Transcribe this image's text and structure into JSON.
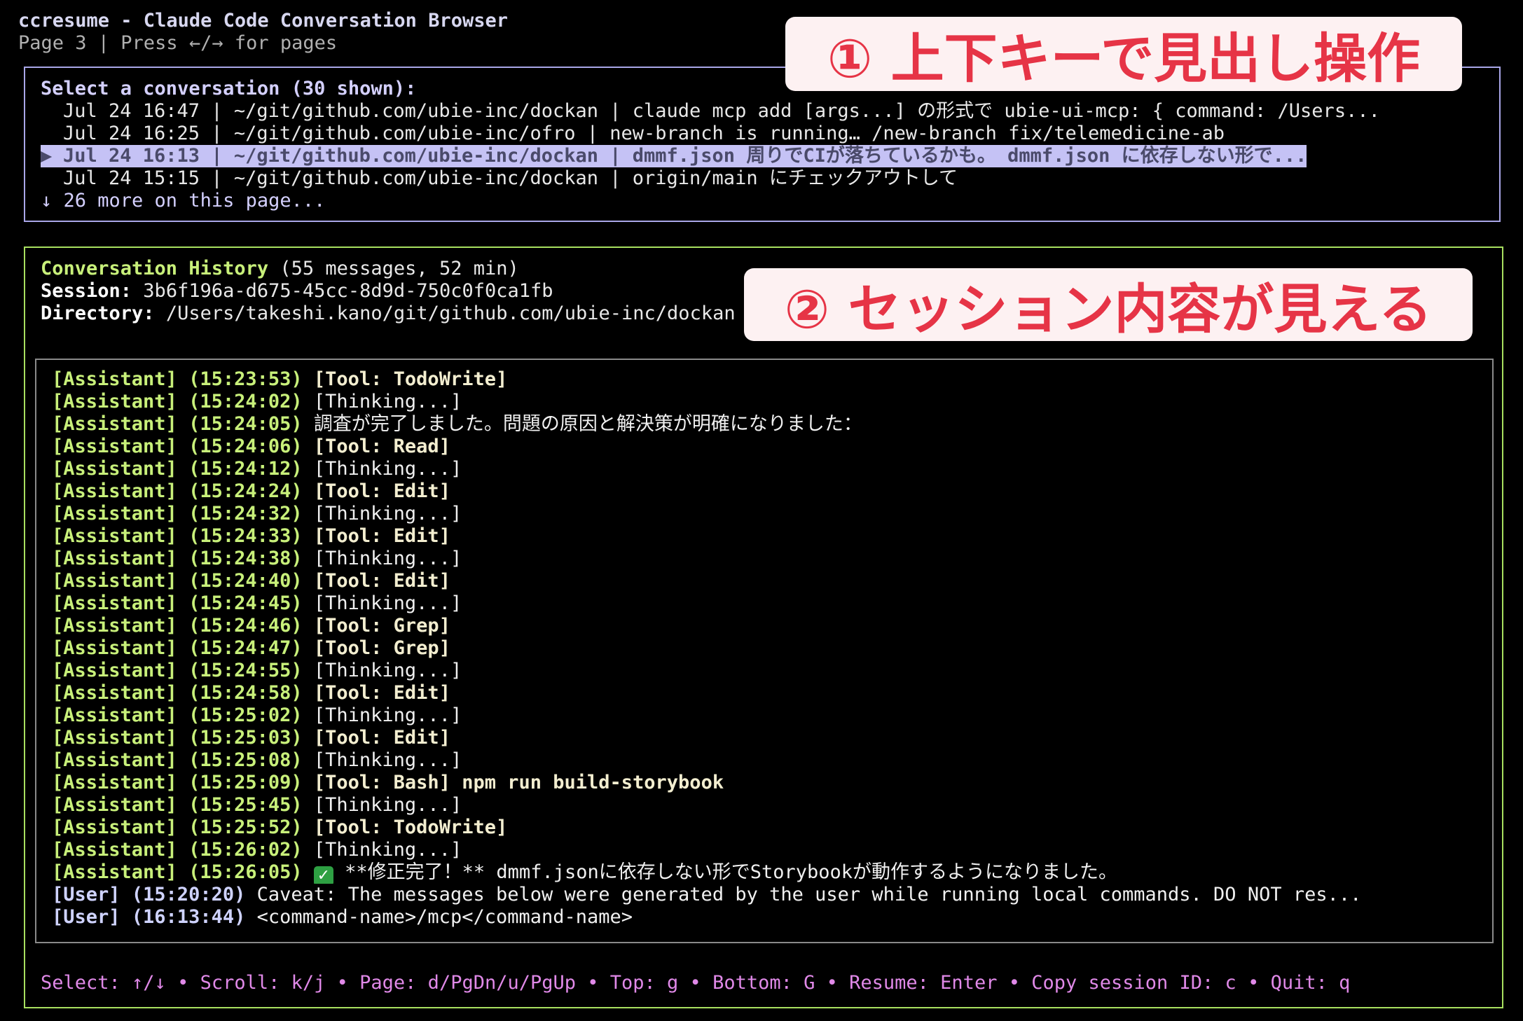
{
  "app": {
    "title": "ccresume - Claude Code Conversation Browser",
    "subtitle": "Page 3 | Press ←/→ for pages"
  },
  "conversation_list": {
    "header": "Select a conversation (30 shown):",
    "selected_marker": "▶",
    "rows": [
      "Jul 24 16:47 | ~/git/github.com/ubie-inc/dockan | claude mcp add [args...] の形式で ubie-ui-mcp: { command: /Users...",
      "Jul 24 16:25 | ~/git/github.com/ubie-inc/ofro | new-branch is running… /new-branch fix/telemedicine-ab",
      "Jul 24 16:13 | ~/git/github.com/ubie-inc/dockan | dmmf.json 周りでCIが落ちているかも。 dmmf.json に依存しない形で...",
      "Jul 24 15:15 | ~/git/github.com/ubie-inc/dockan | origin/main にチェックアウトして"
    ],
    "more": "↓ 26 more on this page..."
  },
  "history": {
    "label": "Conversation History",
    "summary": " (55 messages, 52 min)",
    "session_label": "Session:",
    "session_id": " 3b6f196a-d675-45cc-8d9d-750c0f0ca1fb",
    "directory_label": "Directory:",
    "directory": " /Users/takeshi.kano/git/github.com/ubie-inc/dockan",
    "messages": [
      {
        "who": "[Assistant] (15:23:53)",
        "text": " [Tool: TodoWrite]"
      },
      {
        "who": "[Assistant] (15:24:02)",
        "text": " [Thinking...]"
      },
      {
        "who": "[Assistant] (15:24:05)",
        "text": " 調査が完了しました。問題の原因と解決策が明確になりました："
      },
      {
        "who": "[Assistant] (15:24:06)",
        "text": " [Tool: Read]"
      },
      {
        "who": "[Assistant] (15:24:12)",
        "text": " [Thinking...]"
      },
      {
        "who": "[Assistant] (15:24:24)",
        "text": " [Tool: Edit]"
      },
      {
        "who": "[Assistant] (15:24:32)",
        "text": " [Thinking...]"
      },
      {
        "who": "[Assistant] (15:24:33)",
        "text": " [Tool: Edit]"
      },
      {
        "who": "[Assistant] (15:24:38)",
        "text": " [Thinking...]"
      },
      {
        "who": "[Assistant] (15:24:40)",
        "text": " [Tool: Edit]"
      },
      {
        "who": "[Assistant] (15:24:45)",
        "text": " [Thinking...]"
      },
      {
        "who": "[Assistant] (15:24:46)",
        "text": " [Tool: Grep]"
      },
      {
        "who": "[Assistant] (15:24:47)",
        "text": " [Tool: Grep]"
      },
      {
        "who": "[Assistant] (15:24:55)",
        "text": " [Thinking...]"
      },
      {
        "who": "[Assistant] (15:24:58)",
        "text": " [Tool: Edit]"
      },
      {
        "who": "[Assistant] (15:25:02)",
        "text": " [Thinking...]"
      },
      {
        "who": "[Assistant] (15:25:03)",
        "text": " [Tool: Edit]"
      },
      {
        "who": "[Assistant] (15:25:08)",
        "text": " [Thinking...]"
      },
      {
        "who": "[Assistant] (15:25:09)",
        "text": " [Tool: Bash] npm run build-storybook"
      },
      {
        "who": "[Assistant] (15:25:45)",
        "text": " [Thinking...]"
      },
      {
        "who": "[Assistant] (15:25:52)",
        "text": " [Tool: TodoWrite]"
      },
      {
        "who": "[Assistant] (15:26:02)",
        "text": " [Thinking...]"
      },
      {
        "who": "[Assistant] (15:26:05)",
        "text": " **修正完了！** dmmf.jsonに依存しない形でStorybookが動作するようになりました。"
      },
      {
        "who": "[User] (15:20:20)",
        "text": " Caveat: The messages below were generated by the user while running local commands. DO NOT res..."
      },
      {
        "who": "[User] (16:13:44)",
        "text": " <command-name>/mcp</command-name>"
      }
    ]
  },
  "footer": "Select: ↑/↓ • Scroll: k/j • Page: d/PgDn/u/PgUp • Top: g • Bottom: G • Resume: Enter • Copy session ID: c • Quit: q",
  "callouts": {
    "first": "① 上下キーで見出し操作",
    "second": "② セッション内容が見える"
  },
  "colors": {
    "background": "#000000",
    "list_border": "#a9a6e8",
    "history_border": "#a8e060",
    "assistant": "#c8f07a",
    "footer": "#e089e8",
    "callout_text": "#e63446",
    "callout_bg": "#fdf1f2",
    "selected_bg": "#c5c2f5"
  },
  "icons": {
    "done": "check-mark-icon"
  }
}
